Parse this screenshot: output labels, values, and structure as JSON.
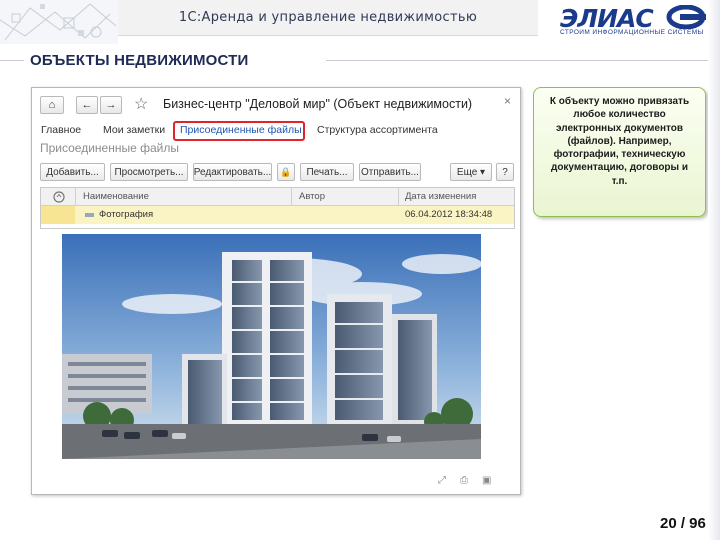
{
  "slide": {
    "header_title": "1С:Аренда и управление недвижимостью",
    "logo_text": "ЭЛИАС",
    "logo_subtitle": "СТРОИМ ИНФОРМАЦИОННЫЕ СИСТЕМЫ",
    "section_title": "ОБЪЕКТЫ НЕДВИЖИМОСТИ",
    "page_number": "20 / 96",
    "callout_text": "К объекту можно привязать любое количество электронных документов (файлов). Например, фотографии, техническую документацию, договоры и т.п."
  },
  "window": {
    "title": "Бизнес-центр \"Деловой мир\" (Объект недвижимости)",
    "nav": {
      "home": "⌂",
      "back": "←",
      "forward": "→",
      "close": "×"
    },
    "tabs": [
      {
        "label": "Главное"
      },
      {
        "label": "Мои заметки"
      },
      {
        "label": "Присоединенные файлы"
      },
      {
        "label": "Структура ассортимента"
      }
    ],
    "subheading": "Присоединенные файлы",
    "toolbar": {
      "add": "Добавить...",
      "view": "Просмотреть...",
      "edit": "Редактировать...",
      "lock_icon": "🔒",
      "print": "Печать...",
      "send": "Отправить...",
      "more": "Еще ▾",
      "help": "?"
    },
    "table": {
      "columns": [
        "Наименование",
        "Автор",
        "Дата изменения"
      ],
      "rows": [
        {
          "name": "Фотография",
          "author": "",
          "date": "06.04.2012 18:34:48"
        }
      ]
    }
  },
  "colors": {
    "highlight": "#e0242c",
    "accent_blue": "#1f56b0",
    "row_selected": "#faf3c4",
    "callout_border": "#8fbf4d"
  },
  "icons": [
    "home-icon",
    "back-arrow-icon",
    "forward-arrow-icon",
    "favorite-star-icon",
    "close-icon",
    "lock-icon",
    "attachment-icon",
    "file-icon"
  ]
}
